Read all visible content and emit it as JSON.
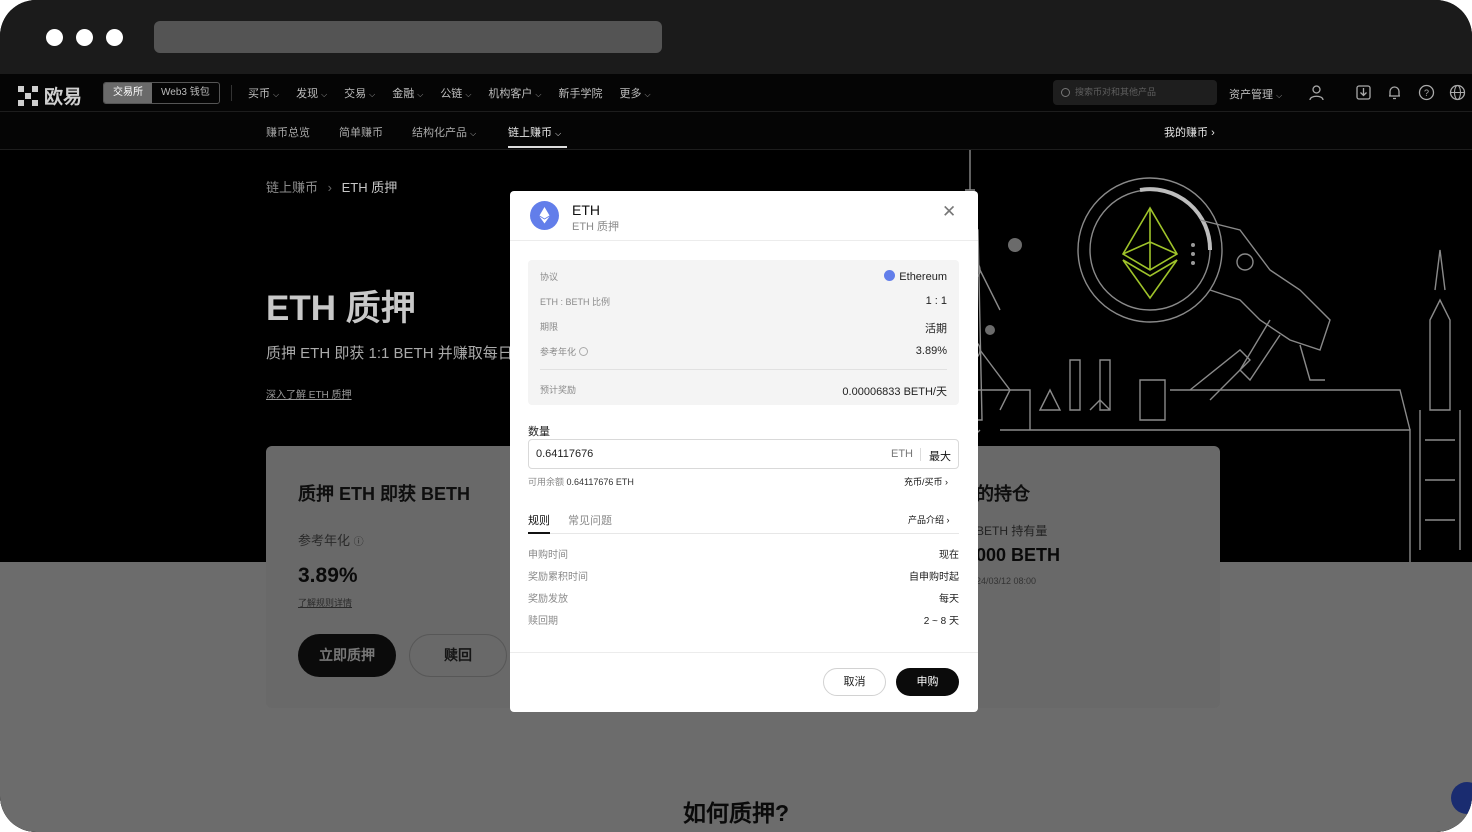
{
  "window": {
    "title_bar_dots": 3
  },
  "topnav": {
    "logo_text": "欧易",
    "segment": [
      "交易所",
      "Web3 钱包"
    ],
    "links": [
      {
        "label": "买币",
        "chevron": true
      },
      {
        "label": "发现",
        "chevron": true
      },
      {
        "label": "交易",
        "chevron": true
      },
      {
        "label": "金融",
        "chevron": true
      },
      {
        "label": "公链",
        "chevron": true
      },
      {
        "label": "机构客户",
        "chevron": true
      },
      {
        "label": "新手学院",
        "chevron": false
      },
      {
        "label": "更多",
        "chevron": true
      }
    ],
    "search_placeholder": "搜索币对和其他产品",
    "asset_menu": "资产管理",
    "icons": [
      "user-icon",
      "download-icon",
      "bell-icon",
      "help-icon",
      "globe-icon"
    ]
  },
  "subnav": {
    "items": [
      "赚币总览",
      "简单赚币",
      "结构化产品",
      "链上赚币"
    ],
    "active": "链上赚币",
    "right_link": "我的赚币"
  },
  "hero": {
    "breadcrumb": [
      "链上赚币",
      "ETH 质押"
    ],
    "title": "ETH 质押",
    "subtitle": "质押 ETH 即获 1:1 BETH 并赚取每日",
    "link": "深入了解 ETH 质押"
  },
  "stake_card": {
    "title": "质押 ETH 即获 BETH",
    "apr_label": "参考年化",
    "apr_value": "3.89%",
    "rules_link": "了解规则详情",
    "stake_button": "立即质押",
    "redeem_button": "赎回"
  },
  "holding_card": {
    "title": "的持仓",
    "holding_label": "BETH 持有量",
    "holding_value": "000 BETH",
    "date": "24/03/12 08:00"
  },
  "how_title": "如何质押?",
  "modal": {
    "title": "ETH",
    "subtitle": "ETH 质押",
    "info": {
      "protocol_label": "协议",
      "protocol_value": "Ethereum",
      "ratio_label": "ETH : BETH 比例",
      "ratio_value": "1 : 1",
      "term_label": "期限",
      "term_value": "活期",
      "apr_label": "参考年化",
      "apr_value": "3.89%",
      "reward_label": "预计奖励",
      "reward_value": "0.00006833 BETH/天"
    },
    "quantity_label": "数量",
    "quantity_value": "0.64117676",
    "quantity_unit": "ETH",
    "max_label": "最大",
    "available_label": "可用余额",
    "available_value": "0.64117676 ETH",
    "deposit_link": "充币/买币",
    "tabs": [
      "规则",
      "常见问题"
    ],
    "active_tab": "规则",
    "product_intro": "产品介绍",
    "rules": [
      {
        "k": "申购时间",
        "v": "现在"
      },
      {
        "k": "奖励累积时间",
        "v": "自申购时起"
      },
      {
        "k": "奖励发放",
        "v": "每天"
      },
      {
        "k": "赎回期",
        "v": "2 ~ 8 天"
      }
    ],
    "cancel_button": "取消",
    "subscribe_button": "申购"
  },
  "colors": {
    "overlay_dark": "#000000",
    "overlay_grey": "#6c6c6c",
    "eth_blue": "#627eea",
    "primary_button": "#0b0b0b"
  }
}
